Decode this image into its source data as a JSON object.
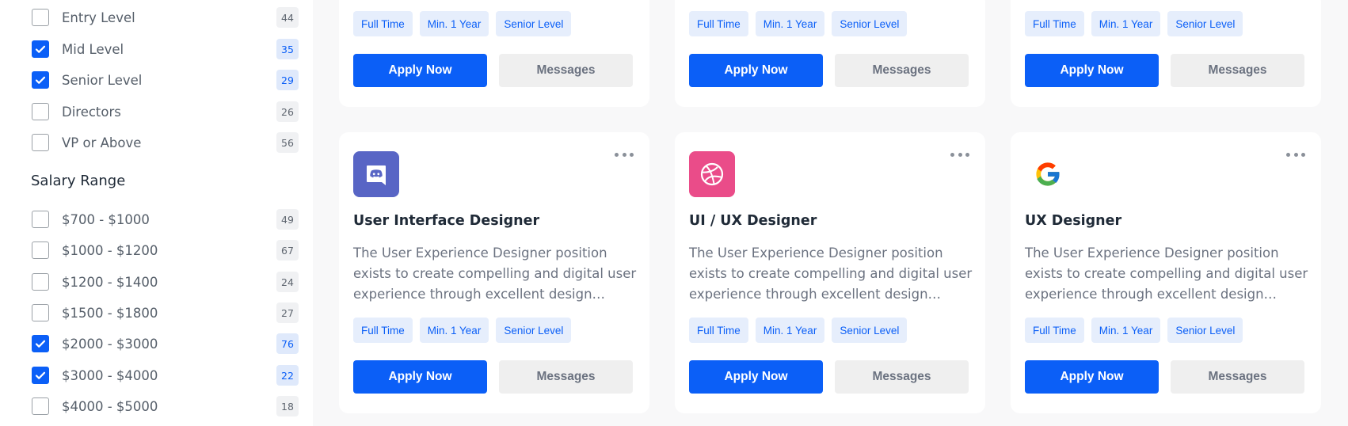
{
  "sidebar": {
    "experience_items": [
      {
        "label": "Entry Level",
        "count": "44",
        "checked": false
      },
      {
        "label": "Mid Level",
        "count": "35",
        "checked": true
      },
      {
        "label": "Senior Level",
        "count": "29",
        "checked": true
      },
      {
        "label": "Directors",
        "count": "26",
        "checked": false
      },
      {
        "label": "VP or Above",
        "count": "56",
        "checked": false
      }
    ],
    "salary_title": "Salary Range",
    "salary_items": [
      {
        "label": "$700 - $1000",
        "count": "49",
        "checked": false
      },
      {
        "label": "$1000 - $1200",
        "count": "67",
        "checked": false
      },
      {
        "label": "$1200 - $1400",
        "count": "24",
        "checked": false
      },
      {
        "label": "$1500 - $1800",
        "count": "27",
        "checked": false
      },
      {
        "label": "$2000 - $3000",
        "count": "76",
        "checked": true
      },
      {
        "label": "$3000 - $4000",
        "count": "22",
        "checked": true
      },
      {
        "label": "$4000 - $5000",
        "count": "18",
        "checked": false
      }
    ]
  },
  "top_cards": [
    {
      "tags": [
        "Full Time",
        "Min. 1 Year",
        "Senior Level"
      ],
      "apply_label": "Apply Now",
      "messages_label": "Messages"
    },
    {
      "tags": [
        "Full Time",
        "Min. 1 Year",
        "Senior Level"
      ],
      "apply_label": "Apply Now",
      "messages_label": "Messages"
    },
    {
      "tags": [
        "Full Time",
        "Min. 1 Year",
        "Senior Level"
      ],
      "apply_label": "Apply Now",
      "messages_label": "Messages"
    }
  ],
  "cards": [
    {
      "logo": "discord-icon",
      "logo_color": "#5865c5",
      "title": "User Interface Designer",
      "description": "The User Experience Designer position exists to create compelling and digital user experience through excellent design…",
      "tags": [
        "Full Time",
        "Min. 1 Year",
        "Senior Level"
      ],
      "apply_label": "Apply Now",
      "messages_label": "Messages"
    },
    {
      "logo": "dribbble-icon",
      "logo_color": "#ea4c89",
      "title": "UI / UX Designer",
      "description": "The User Experience Designer position exists to create compelling and digital user experience through excellent design…",
      "tags": [
        "Full Time",
        "Min. 1 Year",
        "Senior Level"
      ],
      "apply_label": "Apply Now",
      "messages_label": "Messages"
    },
    {
      "logo": "google-icon",
      "logo_color": "#ffffff",
      "title": "UX Designer",
      "description": "The User Experience Designer position exists to create compelling and digital user experience through excellent design…",
      "tags": [
        "Full Time",
        "Min. 1 Year",
        "Senior Level"
      ],
      "apply_label": "Apply Now",
      "messages_label": "Messages"
    }
  ],
  "colors": {
    "accent": "#0b5ff7",
    "tag_bg": "#e6eefc",
    "messages_bg": "#efefef"
  }
}
